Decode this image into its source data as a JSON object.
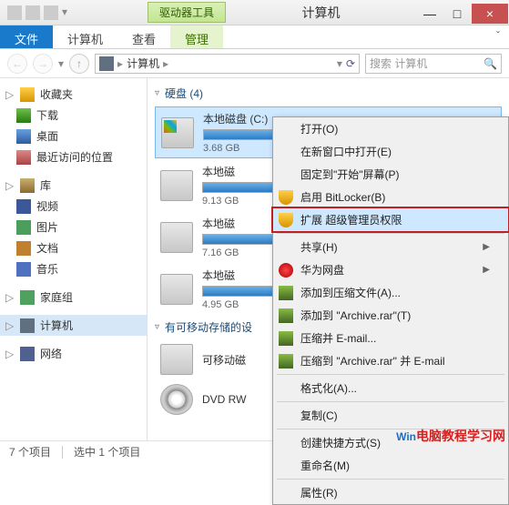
{
  "window": {
    "title": "计算机",
    "tool_tab": "驱动器工具"
  },
  "win_buttons": {
    "min": "—",
    "max": "□",
    "close": "×"
  },
  "ribbon": {
    "file": "文件",
    "computer": "计算机",
    "view": "查看",
    "manage": "管理",
    "expand": "ˇ"
  },
  "nav": {
    "back": "←",
    "fwd": "→",
    "drop": "▾",
    "up": "↑",
    "crumb_root": "计算机",
    "sep": "▸",
    "refresh": "⟳",
    "search_placeholder": "搜索 计算机"
  },
  "sidebar": {
    "favorites": "收藏夹",
    "downloads": "下载",
    "desktop": "桌面",
    "recent": "最近访问的位置",
    "libraries": "库",
    "videos": "视频",
    "pictures": "图片",
    "documents": "文档",
    "music": "音乐",
    "homegroup": "家庭组",
    "computer": "计算机",
    "network": "网络"
  },
  "main": {
    "hdd_header": "硬盘 (4)",
    "removable_header": "有可移动存储的设",
    "drives": [
      {
        "name": "本地磁盘 (C:)",
        "free": "3.68 GB",
        "fill": 78
      },
      {
        "name": "本地磁",
        "free": "9.13 GB",
        "fill": 55
      },
      {
        "name": "本地磁",
        "free": "7.16 GB",
        "fill": 62
      },
      {
        "name": "本地磁",
        "free": "4.95 GB",
        "fill": 70
      }
    ],
    "removable": [
      {
        "name": "可移动磁"
      },
      {
        "name": "DVD RW"
      }
    ]
  },
  "context_menu": {
    "open": "打开(O)",
    "open_new_window": "在新窗口中打开(E)",
    "pin_start": "固定到\"开始\"屏幕(P)",
    "bitlocker": "启用 BitLocker(B)",
    "admin_rights": "扩展 超级管理员权限",
    "share": "共享(H)",
    "huawei": "华为网盘",
    "add_archive": "添加到压缩文件(A)...",
    "add_archive_rar": "添加到 \"Archive.rar\"(T)",
    "compress_email": "压缩并 E-mail...",
    "compress_rar_email": "压缩到 \"Archive.rar\" 并 E-mail",
    "format": "格式化(A)...",
    "copy": "复制(C)",
    "shortcut": "创建快捷方式(S)",
    "rename": "重命名(M)",
    "properties": "属性(R)"
  },
  "status": {
    "items": "7 个项目",
    "selected": "选中 1 个项目"
  },
  "watermark": {
    "blue": "Win",
    "red": "电脑教程学习网"
  }
}
